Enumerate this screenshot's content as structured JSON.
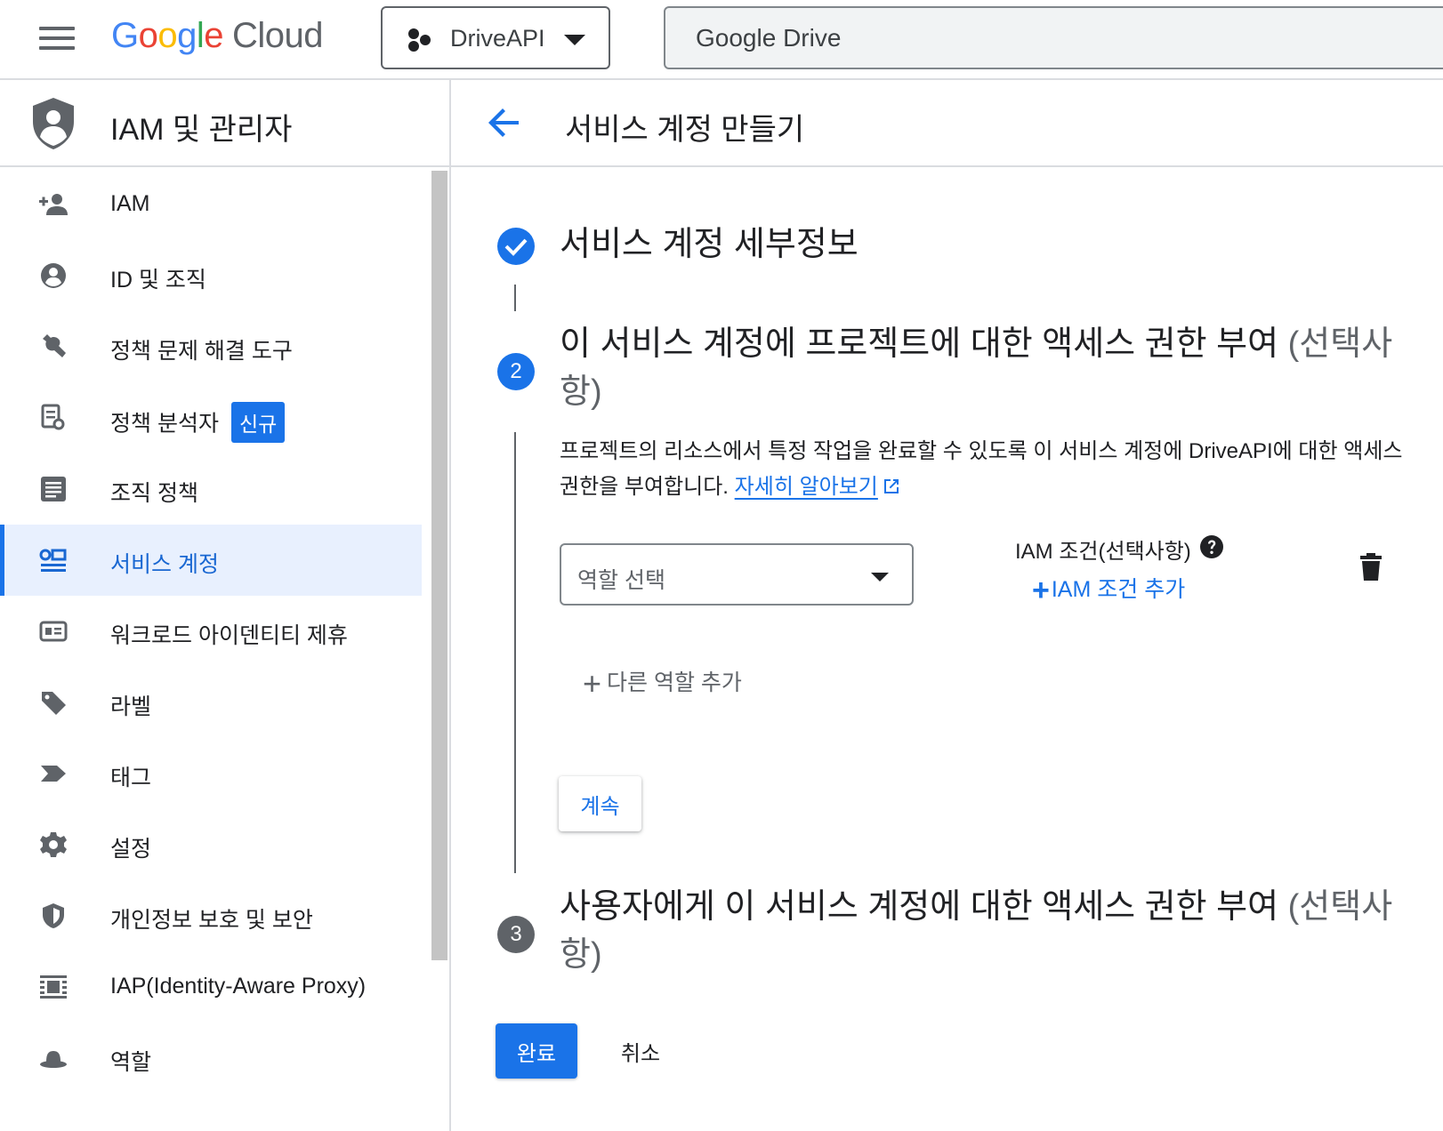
{
  "topbar": {
    "logo_google": [
      "G",
      "o",
      "o",
      "g",
      "l",
      "e"
    ],
    "logo_cloud": "Cloud",
    "project_name": "DriveAPI",
    "search_value": "Google Drive"
  },
  "sidebar": {
    "title": "IAM 및 관리자",
    "items": [
      {
        "label": "IAM",
        "icon": "person-add-icon"
      },
      {
        "label": "ID 및 조직",
        "icon": "account-circle-icon"
      },
      {
        "label": "정책 문제 해결 도구",
        "icon": "wrench-icon"
      },
      {
        "label": "정책 분석자",
        "icon": "policy-analyzer-icon",
        "badge": "신규"
      },
      {
        "label": "조직 정책",
        "icon": "article-icon"
      },
      {
        "label": "서비스 계정",
        "icon": "service-account-icon",
        "active": true
      },
      {
        "label": "워크로드 아이덴티티 제휴",
        "icon": "id-card-icon"
      },
      {
        "label": "라벨",
        "icon": "label-tag-icon"
      },
      {
        "label": "태그",
        "icon": "chevron-tag-icon"
      },
      {
        "label": "설정",
        "icon": "gear-icon"
      },
      {
        "label": "개인정보 보호 및 보안",
        "icon": "shield-icon"
      },
      {
        "label": "IAP(Identity-Aware Proxy)",
        "icon": "iap-icon"
      },
      {
        "label": "역할",
        "icon": "hat-icon"
      }
    ]
  },
  "main": {
    "title": "서비스 계정 만들기",
    "step1": {
      "title": "서비스 계정 세부정보"
    },
    "step2": {
      "number": "2",
      "title": "이 서비스 계정에 프로젝트에 대한 액세스 권한 부여 ",
      "optional": "(선택사항)",
      "description": "프로젝트의 리소스에서 특정 작업을 완료할 수 있도록 이 서비스 계정에 DriveAPI에 대한 액세스 권한을 부여합니다. ",
      "learn_more": "자세히 알아보기",
      "role_select": "역할 선택",
      "iam_condition_label": "IAM 조건(선택사항)",
      "add_condition": "IAM 조건 추가",
      "add_role": "다른 역할 추가",
      "continue": "계속"
    },
    "step3": {
      "number": "3",
      "title": "사용자에게 이 서비스 계정에 대한 액세스 권한 부여 ",
      "optional": "(선택사항)"
    },
    "done": "완료",
    "cancel": "취소"
  },
  "colors": {
    "accent": "#1a73e8",
    "active_bg": "#e8f0fe",
    "inactive_step": "#5f6368"
  }
}
